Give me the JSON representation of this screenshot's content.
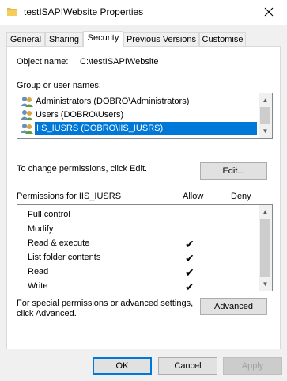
{
  "window": {
    "title": "testISAPIWebsite Properties"
  },
  "tabs": [
    "General",
    "Sharing",
    "Security",
    "Previous Versions",
    "Customise"
  ],
  "security": {
    "object_name_label": "Object name:",
    "object_name_value": "C:\\testISAPIWebsite",
    "group_label": "Group or user names:",
    "groups": [
      "Administrators (DOBRO\\Administrators)",
      "Users (DOBRO\\Users)",
      "IIS_IUSRS (DOBRO\\IIS_IUSRS)"
    ],
    "selected_group_index": 2,
    "change_hint": "To change permissions, click Edit.",
    "edit_button": "Edit...",
    "permissions_label": "Permissions for IIS_IUSRS",
    "allow_header": "Allow",
    "deny_header": "Deny",
    "permissions": [
      {
        "name": "Full control",
        "allow": false,
        "deny": false
      },
      {
        "name": "Modify",
        "allow": false,
        "deny": false
      },
      {
        "name": "Read & execute",
        "allow": true,
        "deny": false
      },
      {
        "name": "List folder contents",
        "allow": true,
        "deny": false
      },
      {
        "name": "Read",
        "allow": true,
        "deny": false
      },
      {
        "name": "Write",
        "allow": true,
        "deny": false
      }
    ],
    "check_glyph": "✔",
    "advanced_hint_line1": "For special permissions or advanced settings,",
    "advanced_hint_line2": "click Advanced.",
    "advanced_button": "Advanced"
  },
  "footer": {
    "ok": "OK",
    "cancel": "Cancel",
    "apply": "Apply"
  }
}
